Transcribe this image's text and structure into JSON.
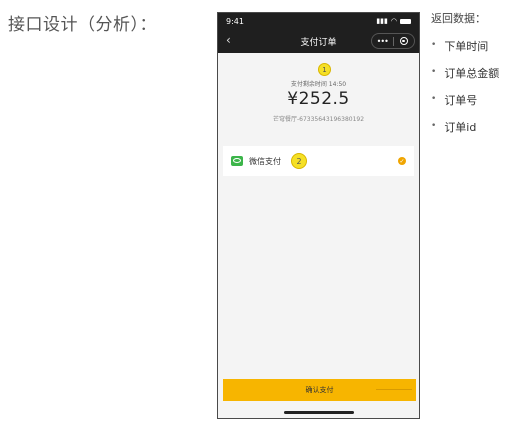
{
  "heading": "接口设计（分析）：",
  "phone": {
    "status_time": "9:41",
    "nav_title": "支付订单",
    "back_icon": "chevron-left-icon",
    "capsule_more": "•••",
    "summary": {
      "marker_1": "1",
      "countdown": "支付剩余时间 14:50",
      "amount": "¥252.5",
      "order_info": "芒穹餐厅-67335643196380192"
    },
    "payment": {
      "method_label": "微信支付",
      "marker_2": "2",
      "check": "✓"
    },
    "confirm_label": "确认支付"
  },
  "returns": {
    "title": "返回数据：",
    "items": [
      "下单时间",
      "订单总金额",
      "订单号",
      "订单id"
    ]
  },
  "colors": {
    "accent": "#f7b500",
    "dark_bar": "#1f1f1f",
    "wechat_green": "#3cb54a",
    "marker_yellow": "#f5e026"
  }
}
